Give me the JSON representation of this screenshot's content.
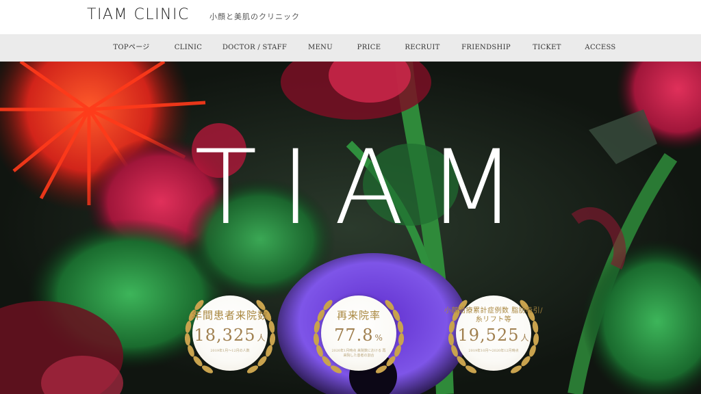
{
  "header": {
    "logo": "TIAM CLINIC",
    "tagline": "小顔と美肌のクリニック"
  },
  "nav": {
    "items": [
      {
        "label": "TOPページ"
      },
      {
        "label": "CLINIC"
      },
      {
        "label": "DOCTOR / STAFF"
      },
      {
        "label": "MENU"
      },
      {
        "label": "PRICE"
      },
      {
        "label": "RECRUIT"
      },
      {
        "label": "FRIENDSHIP"
      },
      {
        "label": "TICKET"
      },
      {
        "label": "ACCESS"
      }
    ]
  },
  "hero": {
    "title": "TIAM"
  },
  "stats": [
    {
      "label": "年間患者来院数",
      "value": "18,325",
      "unit": "人",
      "note": "2019年1月〜12月の人数"
    },
    {
      "label": "再来院率",
      "value": "77.8",
      "unit": "%",
      "note": "2020年1月時点 来院数における 再来院した患者の割合"
    },
    {
      "label": "小顔治療累計症例数 脂肪吸引/糸リフト等",
      "value": "19,525",
      "unit": "人",
      "note": "2019年10月〜2020年12月時点"
    }
  ],
  "colors": {
    "gold": "#a9873f",
    "nav_bg": "#ebebeb",
    "hero_bg": "#141a15"
  }
}
